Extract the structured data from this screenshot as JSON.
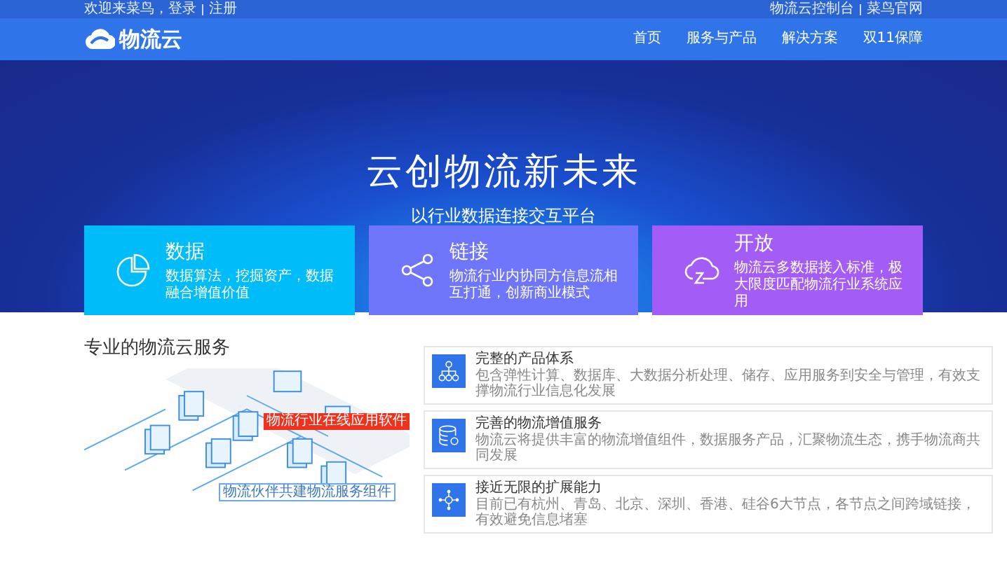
{
  "top_bar": {
    "welcome": "欢迎来菜鸟，",
    "links_left": [
      "登录",
      "注册"
    ],
    "links_right": [
      "物流云控制台",
      "菜鸟官网"
    ]
  },
  "nav": {
    "logo": "物流云",
    "items": [
      {
        "label": "首页",
        "selected": false
      },
      {
        "label": "服务与产品",
        "selected": false
      },
      {
        "label": "解决方案",
        "selected": false
      },
      {
        "label": "双11保障",
        "selected": false
      }
    ]
  },
  "hero": {
    "title": "云创物流新未来",
    "subtitle": "以行业数据连接交互平台"
  },
  "features": [
    {
      "kind": "pie",
      "title": "数据",
      "text": "数据算法，挖掘资产，数据融合增值价值",
      "color": "#00bdfa"
    },
    {
      "kind": "share",
      "title": "链接",
      "text": "物流行业内协同方信息流相互打通，创新商业模式",
      "color": "#6f76fb"
    },
    {
      "kind": "cloud",
      "title": "开放",
      "text": "物流云多数据接入标准，极大限度匹配物流行业系统应用",
      "color": "#a35cf6"
    }
  ],
  "services": {
    "heading": "专业的物流云服务",
    "labels": [
      "物流行业在线应用软件",
      "物流伙伴共建物流服务组件"
    ],
    "items": [
      {
        "kind": "hierarchy",
        "title": "完整的产品体系",
        "text": "包含弹性计算、数据库、大数据分析处理、储存、应用服务到安全与管理，有效支撑物流行业信息化发展"
      },
      {
        "kind": "database",
        "title": "完善的物流增值服务",
        "text": "物流云将提供丰富的物流增值组件，数据服务产品，汇聚物流生态，携手物流商共同发展"
      },
      {
        "kind": "nodes",
        "title": "接近无限的扩展能力",
        "text": "目前已有杭州、青岛、北京、深圳、香港、硅谷6大节点，各节点之间跨域链接，有效避免信息堵塞"
      }
    ]
  }
}
